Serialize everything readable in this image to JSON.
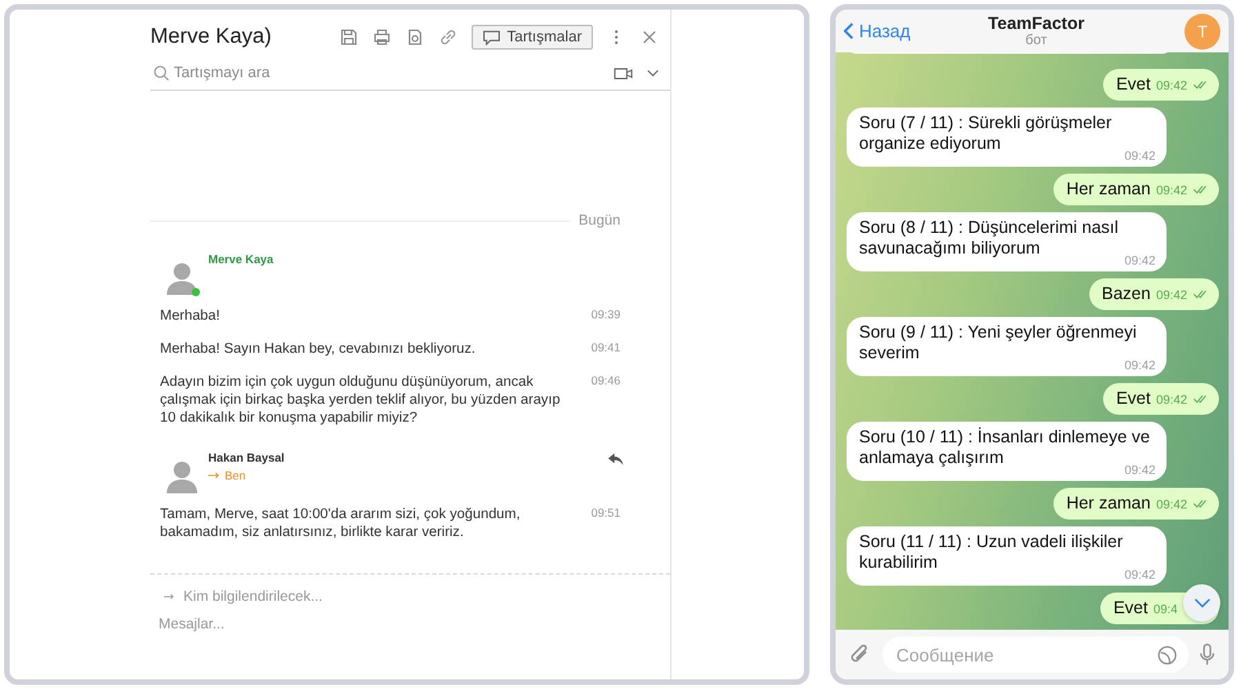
{
  "email_panel": {
    "title": "Merve Kaya)",
    "discussions_button": "Tartışmalar",
    "search": {
      "placeholder": "Tartışmayı ara"
    },
    "date_divider": "Bugün",
    "groups": [
      {
        "sender": "Merve Kaya",
        "color": "#2f9a45",
        "online": true,
        "show_reply": false,
        "messages": [
          {
            "text": "Merhaba!",
            "time": "09:39"
          },
          {
            "text": "Merhaba! Sayın Hakan bey, cevabınızı bekliyoruz.",
            "time": "09:41"
          },
          {
            "text": "Adayın bizim için çok uygun olduğunu düşünüyorum, ancak çalışmak için birkaç başka yerden teklif alıyor, bu yüzden arayıp 10 dakikalık bir konuşma yapabilir miyiz?",
            "time": "09:46"
          }
        ]
      },
      {
        "sender": "Hakan Baysal",
        "color": "#333333",
        "online": false,
        "recipient": "Ben",
        "show_reply": true,
        "messages": [
          {
            "text": "Tamam, Merve, saat 10:00'da ararım sizi, çok yoğundum, bakamadım, siz anlatırsınız, birlikte karar veririz.",
            "time": "09:51"
          }
        ]
      }
    ],
    "compose": {
      "recipients_placeholder": "Kim bilgilendirilecek...",
      "message_placeholder": "Mesajlar..."
    }
  },
  "telegram": {
    "back": "Назад",
    "title": "TeamFactor",
    "subtitle": "бот",
    "avatar": "T",
    "messages": [
      {
        "kind": "out",
        "text": "Evet",
        "time": "09:42"
      },
      {
        "kind": "in",
        "text": "Soru (7 / 11) : Sürekli görüşmeler organize ediyorum",
        "time": "09:42"
      },
      {
        "kind": "out",
        "text": "Her zaman",
        "time": "09:42"
      },
      {
        "kind": "in",
        "text": "Soru (8 / 11) : Düşüncelerimi nasıl savunacağımı biliyorum",
        "time": "09:42"
      },
      {
        "kind": "out",
        "text": "Bazen",
        "time": "09:42"
      },
      {
        "kind": "in",
        "text": "Soru (9 / 11) : Yeni şeyler öğrenmeyi severim",
        "time": "09:42"
      },
      {
        "kind": "out",
        "text": "Evet",
        "time": "09:42"
      },
      {
        "kind": "in",
        "text": "Soru (10 / 11) : İnsanları dinlemeye ve anlamaya çalışırım",
        "time": "09:42"
      },
      {
        "kind": "out",
        "text": "Her zaman",
        "time": "09:42"
      },
      {
        "kind": "in",
        "text": "Soru (11 / 11) : Uzun vadeli ilişkiler kurabilirim",
        "time": "09:42"
      },
      {
        "kind": "out",
        "text": "Evet",
        "time": "09:4",
        "partial": true
      }
    ],
    "input": {
      "placeholder": "Сообщение"
    }
  }
}
